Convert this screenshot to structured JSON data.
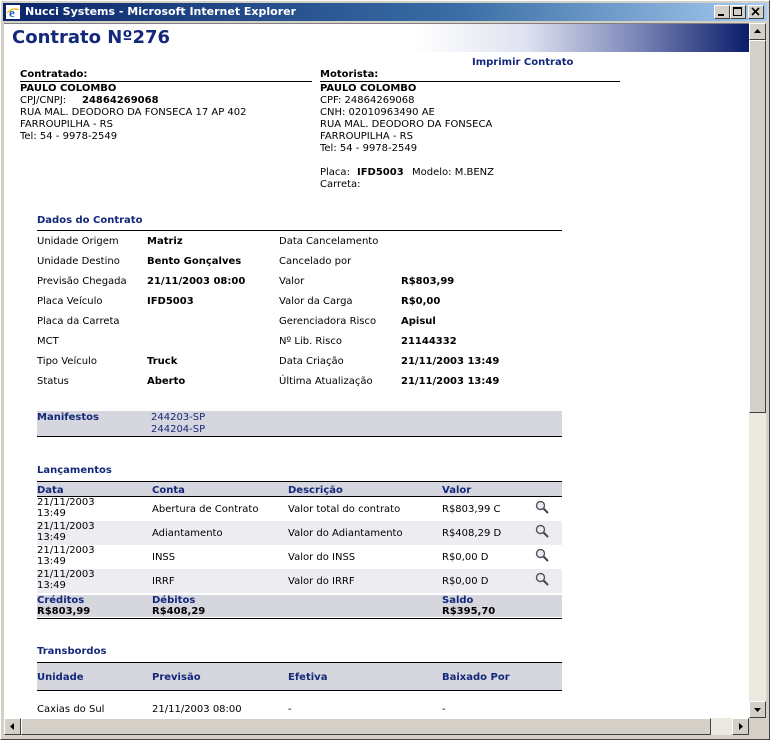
{
  "window": {
    "title": "Nucci Systems - Microsoft Internet Explorer"
  },
  "page": {
    "title": "Contrato Nº276",
    "print_link": "Imprimir Contrato"
  },
  "contratado": {
    "heading": "Contratado:",
    "name": "PAULO COLOMBO",
    "cpj_label": "CPJ/CNPJ:",
    "cpj_value": "24864269068",
    "address": "RUA MAL. DEODORO DA FONSECA 17 AP 402",
    "city": "FARROUPILHA - RS",
    "tel": "Tel: 54 - 9978-2549"
  },
  "motorista": {
    "heading": "Motorista:",
    "name": "PAULO COLOMBO",
    "cpf": "CPF: 24864269068",
    "cnh": "CNH: 02010963490 AE",
    "address": "RUA MAL. DEODORO DA FONSECA",
    "city": "FARROUPILHA - RS",
    "tel": "Tel: 54 - 9978-2549",
    "placa_label": "Placa:",
    "placa_value": "IFD5003",
    "modelo": "Modelo: M.BENZ",
    "carreta": "Carreta:"
  },
  "dados": {
    "heading": "Dados do Contrato",
    "left": [
      {
        "label": "Unidade Origem",
        "value": "Matriz"
      },
      {
        "label": "Unidade Destino",
        "value": "Bento Gonçalves"
      },
      {
        "label": "Previsão Chegada",
        "value": "21/11/2003 08:00"
      },
      {
        "label": "Placa Veículo",
        "value": "IFD5003"
      },
      {
        "label": "Placa da Carreta",
        "value": ""
      },
      {
        "label": "MCT",
        "value": ""
      },
      {
        "label": "Tipo Veículo",
        "value": "Truck"
      },
      {
        "label": "Status",
        "value": "Aberto"
      }
    ],
    "right": [
      {
        "label": "Data Cancelamento",
        "value": ""
      },
      {
        "label": "Cancelado por",
        "value": ""
      },
      {
        "label": "Valor",
        "value": "R$803,99"
      },
      {
        "label": "Valor da Carga",
        "value": "R$0,00"
      },
      {
        "label": "Gerenciadora Risco",
        "value": "Apisul"
      },
      {
        "label": "Nº Lib. Risco",
        "value": "21144332"
      },
      {
        "label": "Data Criação",
        "value": "21/11/2003 13:49"
      },
      {
        "label": "Última Atualização",
        "value": "21/11/2003 13:49"
      }
    ]
  },
  "manifestos": {
    "label": "Manifestos",
    "items": [
      "244203-SP",
      "244204-SP"
    ]
  },
  "lancamentos": {
    "heading": "Lançamentos",
    "columns": [
      "Data",
      "Conta",
      "Descrição",
      "Valor"
    ],
    "rows": [
      {
        "date1": "21/11/2003",
        "date2": "13:49",
        "conta": "Abertura de Contrato",
        "descricao": "Valor total do contrato",
        "valor": "R$803,99 C"
      },
      {
        "date1": "21/11/2003",
        "date2": "13:49",
        "conta": "Adiantamento",
        "descricao": "Valor do Adiantamento",
        "valor": "R$408,29 D"
      },
      {
        "date1": "21/11/2003",
        "date2": "13:49",
        "conta": "INSS",
        "descricao": "Valor do INSS",
        "valor": "R$0,00 D"
      },
      {
        "date1": "21/11/2003",
        "date2": "13:49",
        "conta": "IRRF",
        "descricao": "Valor do IRRF",
        "valor": "R$0,00 D"
      }
    ],
    "totals": {
      "creditos_label": "Créditos",
      "creditos_value": "R$803,99",
      "debitos_label": "Débitos",
      "debitos_value": "R$408,29",
      "saldo_label": "Saldo",
      "saldo_value": "R$395,70"
    }
  },
  "transbordos": {
    "heading": "Transbordos",
    "columns": [
      "Unidade",
      "Previsão",
      "Efetiva",
      "Baixado Por"
    ],
    "rows": [
      {
        "unidade": "Caxias do Sul",
        "previsao": "21/11/2003 08:00",
        "efetiva": "-",
        "baixado": "-"
      }
    ]
  },
  "colors": {
    "accent": "#14287a",
    "band": "#d6d6de",
    "titlebar": "#0a246a"
  }
}
